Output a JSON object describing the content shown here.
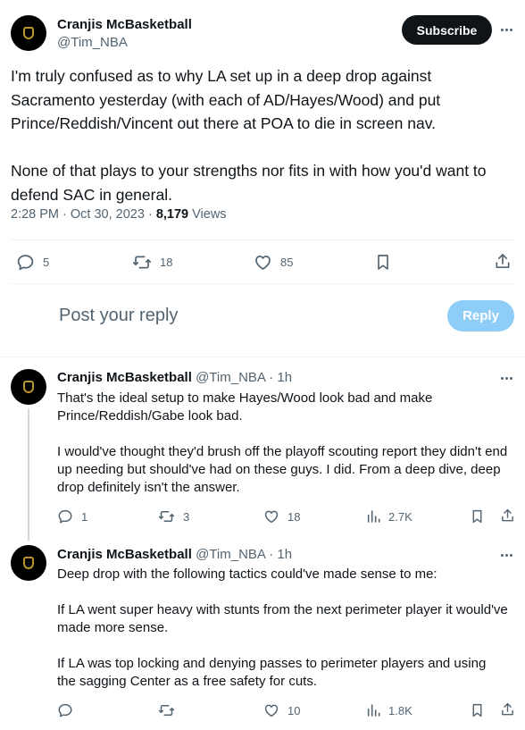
{
  "main_tweet": {
    "author_name": "Cranjis McBasketball",
    "author_handle": "@Tim_NBA",
    "subscribe_label": "Subscribe",
    "paragraphs": [
      "I'm truly confused as to why LA set up in a deep drop against Sacramento yesterday (with each of AD/Hayes/Wood) and put Prince/Reddish/Vincent out there at POA to die in screen nav.",
      "None of that plays to your strengths nor fits in with how you'd want to defend SAC in general."
    ],
    "time": "2:28 PM · Oct 30, 2023 · ",
    "views_count": "8,179",
    "views_label": " Views",
    "replies": "5",
    "reposts": "18",
    "likes": "85"
  },
  "composer": {
    "placeholder": "Post your reply",
    "reply_label": "Reply"
  },
  "replies": [
    {
      "author_name": "Cranjis McBasketball",
      "meta": " @Tim_NBA · 1h",
      "paragraphs": [
        "That's the ideal setup to make Hayes/Wood look bad and make Prince/Reddish/Gabe look bad.",
        "I would've thought they'd brush off the playoff scouting report they didn't end up needing but should've had on these guys. I did. From a deep dive, deep drop definitely isn't the answer."
      ],
      "replies": "1",
      "reposts": "3",
      "likes": "18",
      "views": "2.7K"
    },
    {
      "author_name": "Cranjis McBasketball",
      "meta": " @Tim_NBA · 1h",
      "paragraphs": [
        "Deep drop with the following tactics could've made sense to me:",
        "If LA went super heavy with stunts from the next perimeter player it would've made more sense.",
        "If LA was top locking and denying passes to perimeter players and using the sagging Center as a free safety for cuts."
      ],
      "replies": "",
      "reposts": "",
      "likes": "10",
      "views": "1.8K"
    }
  ],
  "colors": {
    "text": "#0f1419",
    "secondary": "#536471",
    "divider": "#eff3f4",
    "reply_button": "#8ecdf8",
    "avatar_bg": "#000000",
    "avatar_emblem": "#b8952e"
  },
  "icons": [
    "more-icon",
    "reply-icon",
    "repost-icon",
    "like-icon",
    "bookmark-icon",
    "share-icon",
    "views-icon"
  ]
}
